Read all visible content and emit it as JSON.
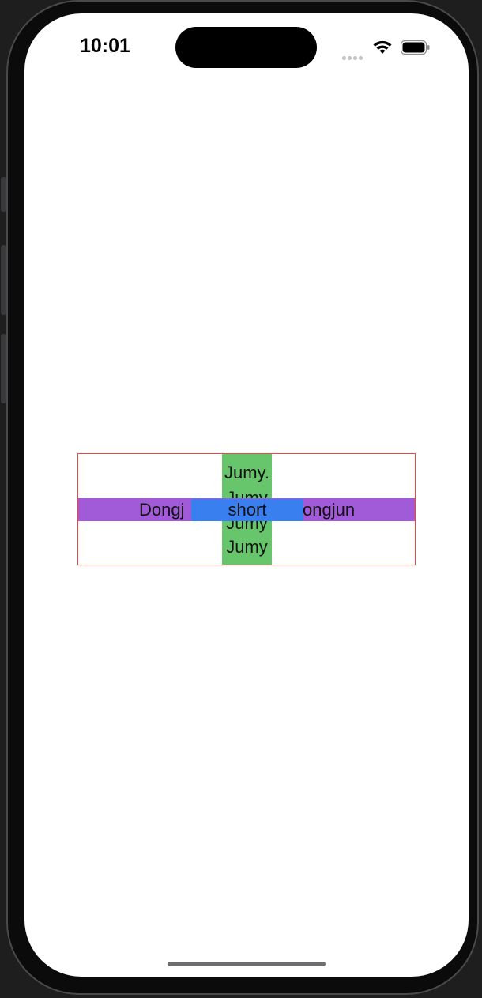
{
  "status_bar": {
    "time": "10:01",
    "icons": [
      "signal-dots-icon",
      "wifi-icon",
      "battery-icon"
    ]
  },
  "content": {
    "green_column_lines": [
      "Jumy.",
      "Jumy",
      "Jumy",
      "Jumy"
    ],
    "purple_row_left": "Dongj",
    "purple_row_right": "ongjun",
    "blue_label": "short"
  },
  "colors": {
    "box_border": "#e8483d",
    "green": "#67c56b",
    "purple": "#a25bd8",
    "blue": "#3a7ff0"
  }
}
